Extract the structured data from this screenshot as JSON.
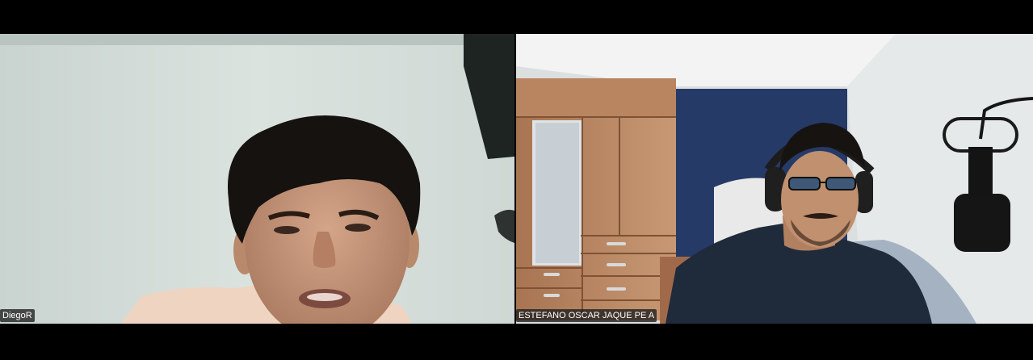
{
  "meeting": {
    "participants": [
      {
        "name": "DiegoR"
      },
      {
        "name": "ESTEFANO OSCAR JAQUE PE A"
      }
    ]
  },
  "colors": {
    "background": "#000000",
    "name_tag_bg": "#1e1e1e",
    "name_tag_text": "#ffffff"
  },
  "icons": []
}
